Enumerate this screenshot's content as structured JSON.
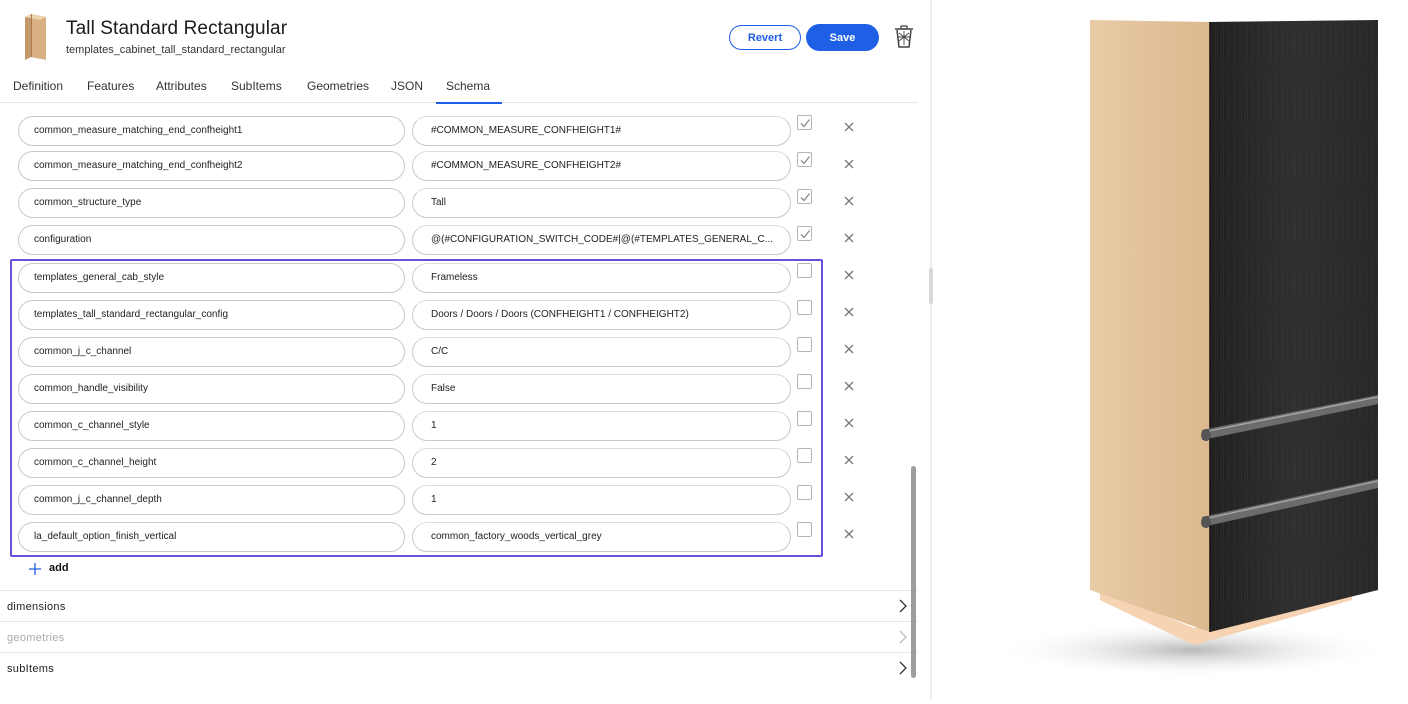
{
  "header": {
    "title": "Tall Standard Rectangular",
    "subtitle": "templates_cabinet_tall_standard_rectangular",
    "revert_label": "Revert",
    "save_label": "Save"
  },
  "tabs": [
    {
      "label": "Definition"
    },
    {
      "label": "Features"
    },
    {
      "label": "Attributes"
    },
    {
      "label": "SubItems"
    },
    {
      "label": "Geometries"
    },
    {
      "label": "JSON"
    },
    {
      "label": "Schema",
      "active": true
    }
  ],
  "rows": [
    {
      "key": "common_measure_matching_end_confheight1",
      "value": "#COMMON_MEASURE_CONFHEIGHT1#",
      "checked": true
    },
    {
      "key": "common_measure_matching_end_confheight2",
      "value": "#COMMON_MEASURE_CONFHEIGHT2#",
      "checked": true
    },
    {
      "key": "common_structure_type",
      "value": "Tall",
      "checked": true
    },
    {
      "key": "configuration",
      "value": "@(#CONFIGURATION_SWITCH_CODE#|@(#TEMPLATES_GENERAL_C...",
      "checked": true
    },
    {
      "key": "templates_general_cab_style",
      "value": "Frameless",
      "checked": false
    },
    {
      "key": "templates_tall_standard_rectangular_config",
      "value": "Doors / Doors / Doors (CONFHEIGHT1 / CONFHEIGHT2)",
      "checked": false
    },
    {
      "key": "common_j_c_channel",
      "value": "C/C",
      "checked": false
    },
    {
      "key": "common_handle_visibility",
      "value": "False",
      "checked": false
    },
    {
      "key": "common_c_channel_style",
      "value": "1",
      "checked": false
    },
    {
      "key": "common_c_channel_height",
      "value": "2",
      "checked": false
    },
    {
      "key": "common_j_c_channel_depth",
      "value": "1",
      "checked": false
    },
    {
      "key": "la_default_option_finish_vertical",
      "value": "common_factory_woods_vertical_grey",
      "checked": false
    }
  ],
  "add_label": "add",
  "sections": [
    {
      "label": "dimensions",
      "dimmed": false
    },
    {
      "label": "geometries",
      "dimmed": true
    },
    {
      "label": "subItems",
      "dimmed": false
    }
  ],
  "colors": {
    "accent": "#1f5fe6",
    "highlight_border": "#6b4fd8",
    "cabinet_side": "#e6c7a3",
    "cabinet_door": "#2a2a2a"
  },
  "icons": {
    "delete": "trash-icon",
    "checkbox": "check-icon",
    "remove": "close-icon",
    "add": "plus-icon",
    "expand": "chevron-right-icon"
  }
}
